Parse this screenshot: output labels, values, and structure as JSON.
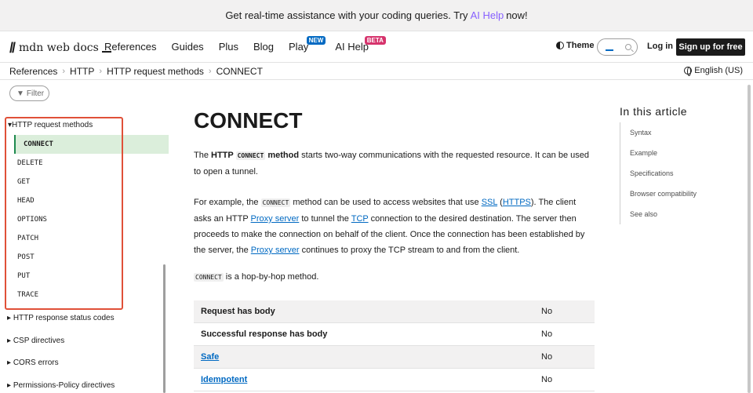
{
  "banner": {
    "before": "Get real-time assistance with your coding queries. Try",
    "link": "AI Help",
    "after": "now!"
  },
  "nav": {
    "logo_text": "mdn web docs",
    "items": [
      {
        "label": "References"
      },
      {
        "label": "Guides"
      },
      {
        "label": "Plus"
      },
      {
        "label": "Blog"
      },
      {
        "label": "Play",
        "badge": "NEW"
      },
      {
        "label": "AI Help",
        "badge": "BETA"
      }
    ],
    "theme_label": "Theme",
    "login_label": "Log in",
    "signup_label": "Sign up for free"
  },
  "breadcrumbs": [
    "References",
    "HTTP",
    "HTTP request methods",
    "CONNECT"
  ],
  "language": "English (US)",
  "filter_label": "Filter",
  "sidebar": {
    "open_group": "HTTP request methods",
    "methods": [
      "CONNECT",
      "DELETE",
      "GET",
      "HEAD",
      "OPTIONS",
      "PATCH",
      "POST",
      "PUT",
      "TRACE"
    ],
    "active": "CONNECT",
    "groups": [
      "HTTP response status codes",
      "CSP directives",
      "CORS errors",
      "Permissions-Policy directives"
    ]
  },
  "article": {
    "title": "CONNECT",
    "p1": {
      "a": "The ",
      "b": "HTTP ",
      "code": "CONNECT",
      "c": " method",
      "d": " starts two-way communications with the requested resource. It can be used to open a tunnel."
    },
    "p2": {
      "a": "For example, the ",
      "code": "CONNECT",
      "b": " method can be used to access websites that use ",
      "ssl": "SSL",
      "c": " (",
      "https": "HTTPS",
      "d": "). The client asks an HTTP ",
      "proxy1": "Proxy server",
      "e": " to tunnel the ",
      "tcp": "TCP",
      "f": " connection to the desired destination. The server then proceeds to make the connection on behalf of the client. Once the connection has been established by the server, the ",
      "proxy2": "Proxy server",
      "g": " continues to proxy the TCP stream to and from the client."
    },
    "p3": {
      "code": "CONNECT",
      "text": " is a hop-by-hop method."
    },
    "table": [
      {
        "label": "Request has body",
        "value": "No",
        "link": false
      },
      {
        "label": "Successful response has body",
        "value": "No",
        "link": false
      },
      {
        "label": "Safe",
        "value": "No",
        "link": true
      },
      {
        "label": "Idempotent",
        "value": "No",
        "link": true
      }
    ]
  },
  "toc": {
    "title": "In this article",
    "items": [
      "Syntax",
      "Example",
      "Specifications",
      "Browser compatibility",
      "See also"
    ]
  }
}
